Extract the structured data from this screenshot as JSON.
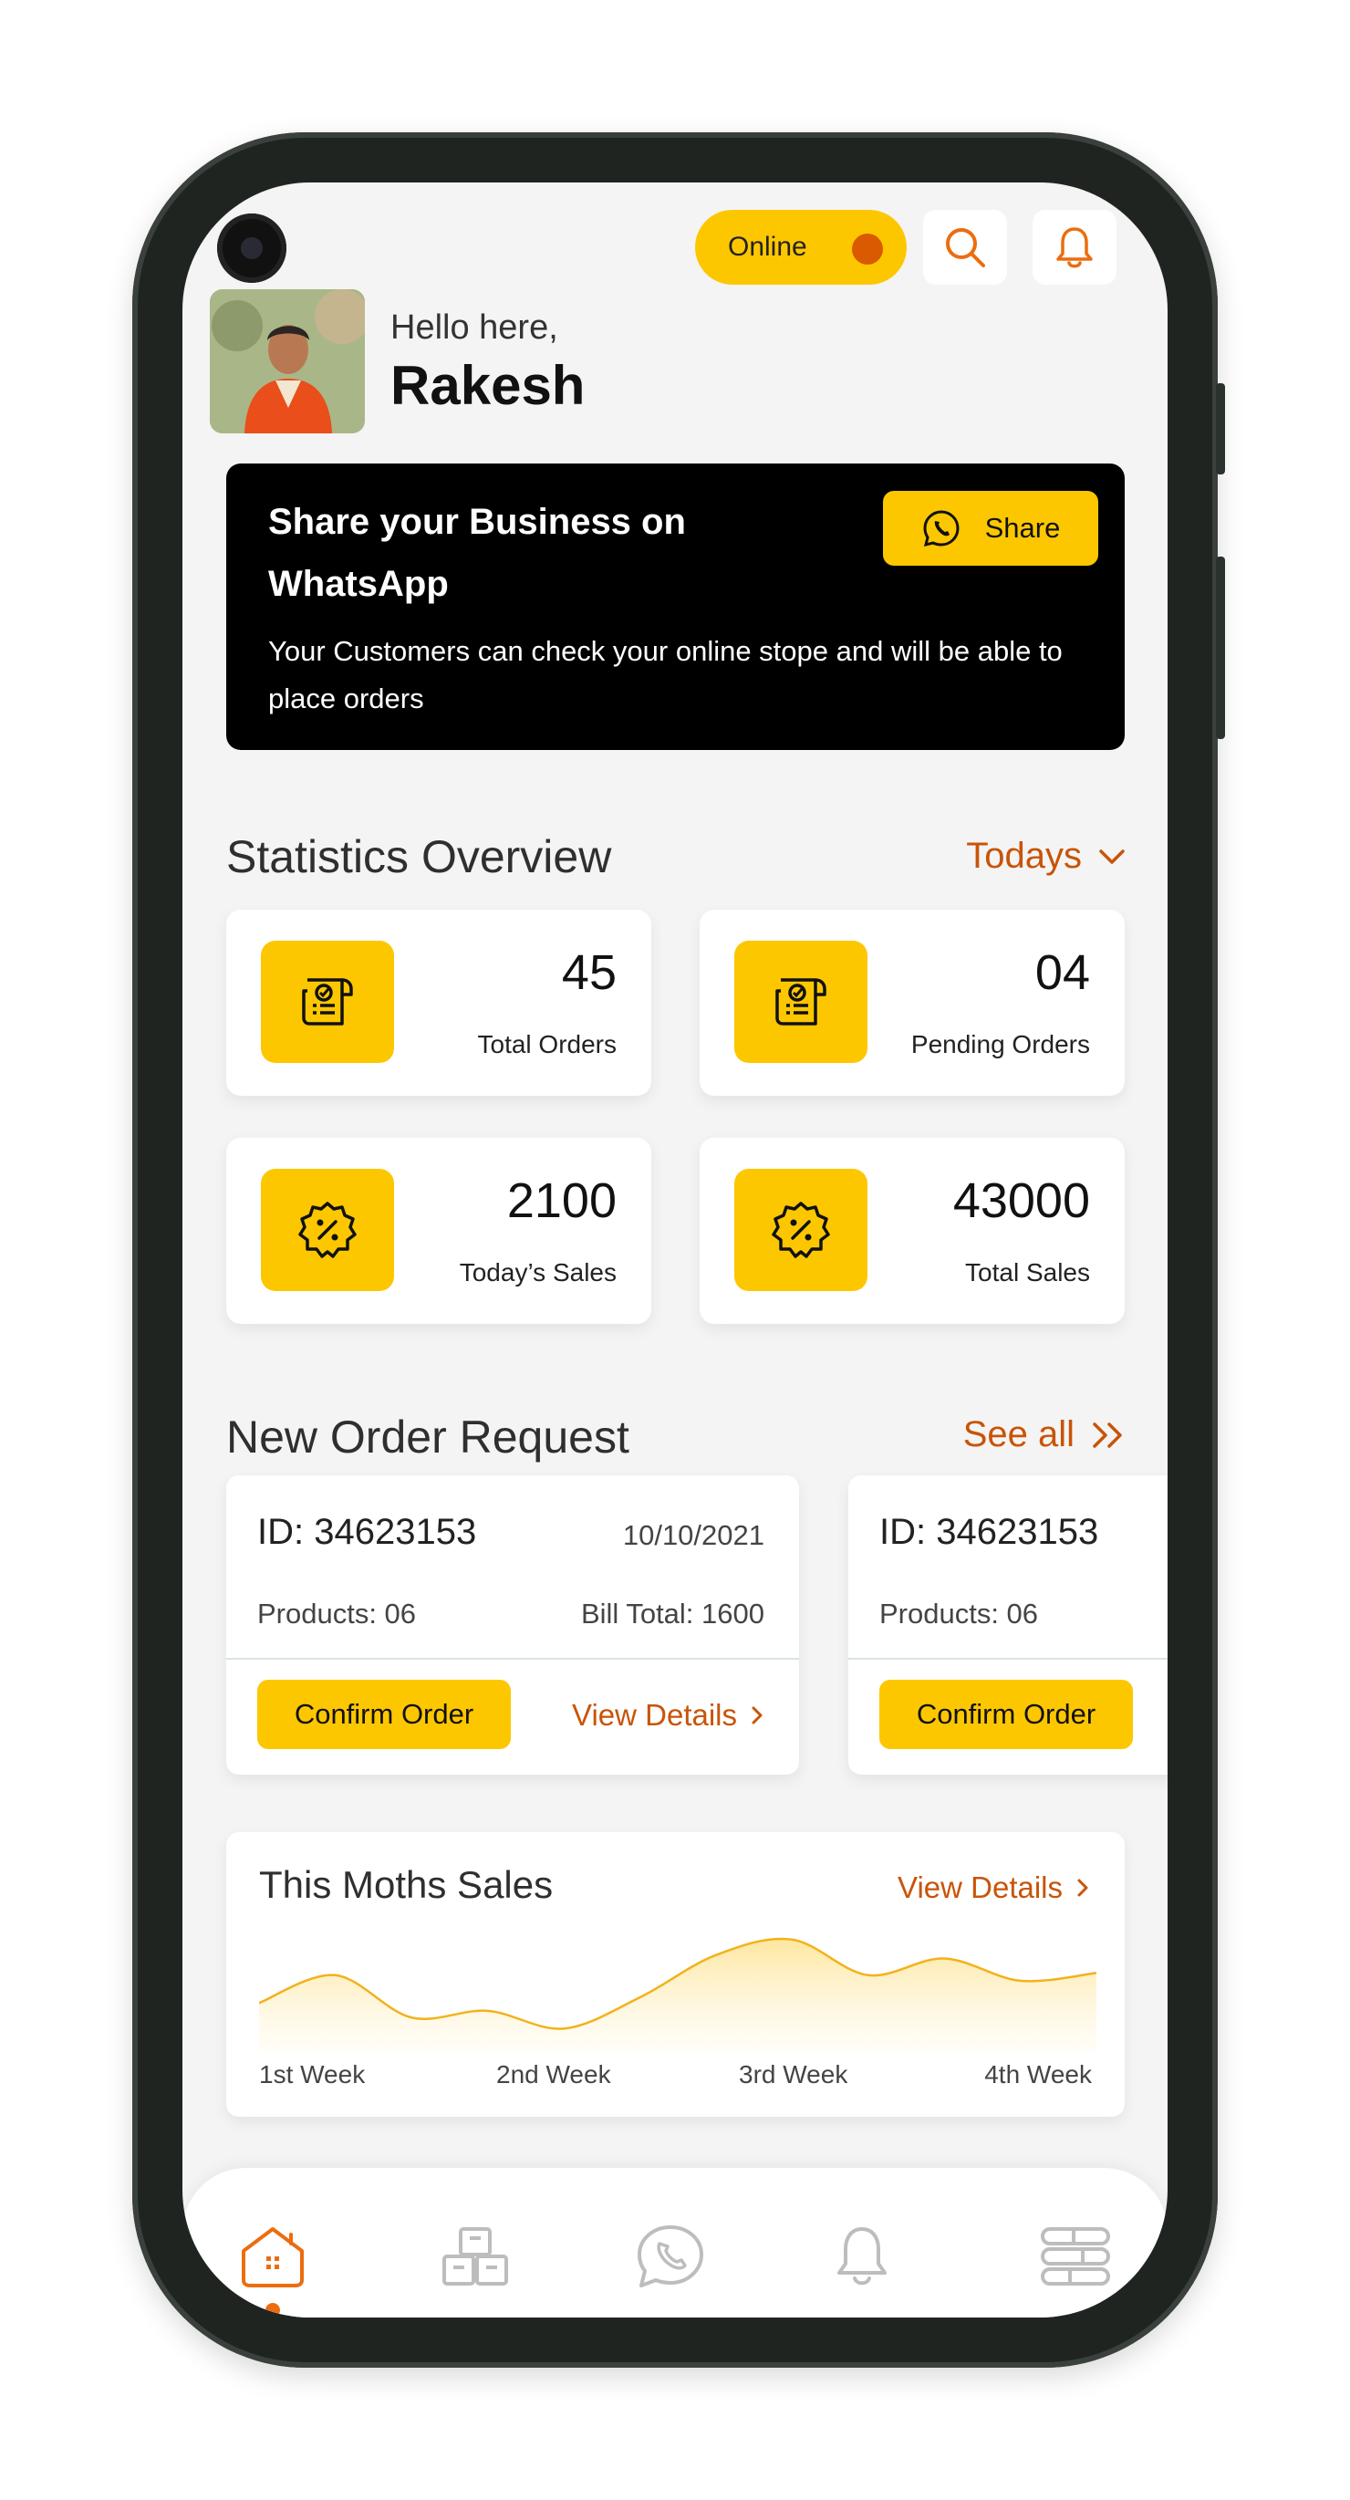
{
  "header": {
    "online_label": "Online",
    "online_dot_color": "#d95a00",
    "search_icon": "search-icon",
    "notification_icon": "bell-icon"
  },
  "greeting": {
    "hello": "Hello here,",
    "name": "Rakesh"
  },
  "whatsapp_banner": {
    "title": "Share your Business on WhatsApp",
    "description": "Your Customers can check your online stope and will be able to place orders",
    "share_label": "Share",
    "share_icon": "whatsapp-icon"
  },
  "statistics": {
    "title": "Statistics Overview",
    "period_label": "Todays",
    "cards": [
      {
        "value": "45",
        "label": "Total Orders",
        "icon": "invoice-icon"
      },
      {
        "value": "04",
        "label": "Pending Orders",
        "icon": "invoice-icon"
      },
      {
        "value": "2100",
        "label": "Today’s Sales",
        "icon": "discount-badge-icon"
      },
      {
        "value": "43000",
        "label": "Total Sales",
        "icon": "discount-badge-icon"
      }
    ]
  },
  "orders": {
    "title": "New Order Request",
    "see_all_label": "See all",
    "items": [
      {
        "id": "ID: 34623153",
        "date": "10/10/2021",
        "products": "Products: 06",
        "bill": "Bill Total: 1600",
        "confirm_label": "Confirm Order",
        "details_label": "View Details"
      },
      {
        "id": "ID: 34623153",
        "products": "Products: 06",
        "confirm_label": "Confirm Order"
      }
    ]
  },
  "monthly_sales": {
    "title": "This Moths Sales",
    "details_label": "View Details",
    "chart_data": {
      "type": "area",
      "categories": [
        "1st Week",
        "2nd Week",
        "3rd Week",
        "4th Week"
      ],
      "series": [
        {
          "values": [
            35,
            60,
            22,
            28,
            12,
            40,
            78,
            92,
            60,
            75,
            55,
            62
          ]
        }
      ],
      "xlabel": "",
      "ylabel": "",
      "color": "#f2b21b"
    }
  },
  "bottom_nav": {
    "items": [
      "home-icon",
      "orders-boxes-icon",
      "whatsapp-icon",
      "bell-icon",
      "menu-icon"
    ],
    "active_color": "#ec6d0e",
    "inactive_color": "#bdbdbd"
  },
  "colors": {
    "accent": "#fdc700",
    "link": "#c85408",
    "background": "#f4f4f4"
  }
}
